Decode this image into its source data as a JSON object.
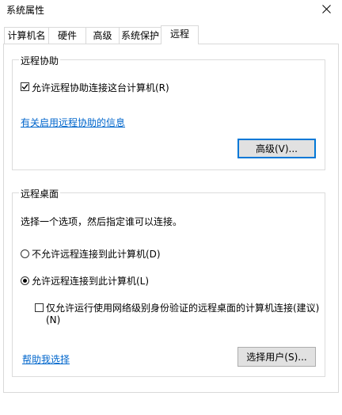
{
  "window": {
    "title": "系统属性"
  },
  "tabs": [
    {
      "label": "计算机名"
    },
    {
      "label": "硬件"
    },
    {
      "label": "高级"
    },
    {
      "label": "系统保护"
    },
    {
      "label": "远程",
      "active": true
    }
  ],
  "remote_assistance": {
    "group_title": "远程协助",
    "allow_checkbox_label": "允许远程协助连接这台计算机(R)",
    "allow_checked": true,
    "info_link": "有关启用远程协助的信息",
    "advanced_button": "高级(V)..."
  },
  "remote_desktop": {
    "group_title": "远程桌面",
    "instruction": "选择一个选项，然后指定谁可以连接。",
    "option_disallow": "不允许远程连接到此计算机(D)",
    "option_allow": "允许远程连接到此计算机(L)",
    "selected_option": "allow",
    "nla_checkbox_line1": "仅允许运行使用网络级别身份验证的远程桌面的计算机连接(建议)",
    "nla_checkbox_line2": "(N)",
    "nla_checked": false,
    "help_link": "帮助我选择",
    "select_users_button": "选择用户(S)..."
  }
}
